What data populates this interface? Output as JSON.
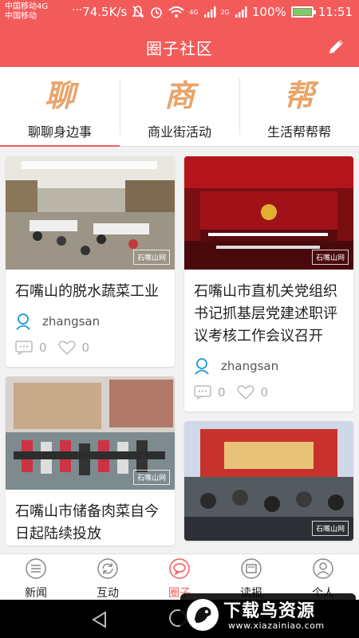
{
  "status_bar": {
    "carrier_1": "中国移动4G",
    "carrier_2": "中国移动",
    "speed": "74.5K/s",
    "network_1": "4G",
    "network_2": "2G",
    "battery": "100%",
    "battery_level": 1.0,
    "time": "11:51"
  },
  "app_bar": {
    "title": "圈子社区",
    "edit_icon": "pencil-icon"
  },
  "tabs": [
    {
      "glyph": "聊",
      "label": "聊聊身边事",
      "active": true
    },
    {
      "glyph": "商",
      "label": "商业街活动",
      "active": false
    },
    {
      "glyph": "帮",
      "label": "生活帮帮帮",
      "active": false
    }
  ],
  "posts": [
    {
      "title": "石嘴山的脱水蔬菜工业",
      "author": "zhangsan",
      "comments": "0",
      "likes": "0",
      "watermark": "石嘴山网"
    },
    {
      "title": "石嘴山市直机关党组织书记抓基层党建述职评议考核工作会议召开",
      "author": "zhangsan",
      "comments": "0",
      "likes": "0",
      "watermark": "石嘴山网"
    },
    {
      "title": "石嘴山市储备肉菜自今日起陆续投放",
      "author": "",
      "comments": "",
      "likes": "",
      "watermark": "石嘴山网"
    },
    {
      "title": "",
      "author": "",
      "comments": "",
      "likes": "",
      "watermark": "石嘴山网"
    }
  ],
  "bottom_nav": [
    {
      "label": "新闻",
      "icon": "menu-icon",
      "active": false
    },
    {
      "label": "互动",
      "icon": "refresh-icon",
      "active": false
    },
    {
      "label": "圈子",
      "icon": "chat-bubble-icon",
      "active": true
    },
    {
      "label": "读报",
      "icon": "newspaper-icon",
      "active": false
    },
    {
      "label": "个人",
      "icon": "person-icon",
      "active": false
    }
  ],
  "watermark_overlay": {
    "title": "下载鸟资源",
    "url": "www.xiazainiao.com"
  },
  "colors": {
    "accent": "#f35b5b",
    "glyph": "#e8a46a",
    "author_icon": "#1a9ad6"
  }
}
